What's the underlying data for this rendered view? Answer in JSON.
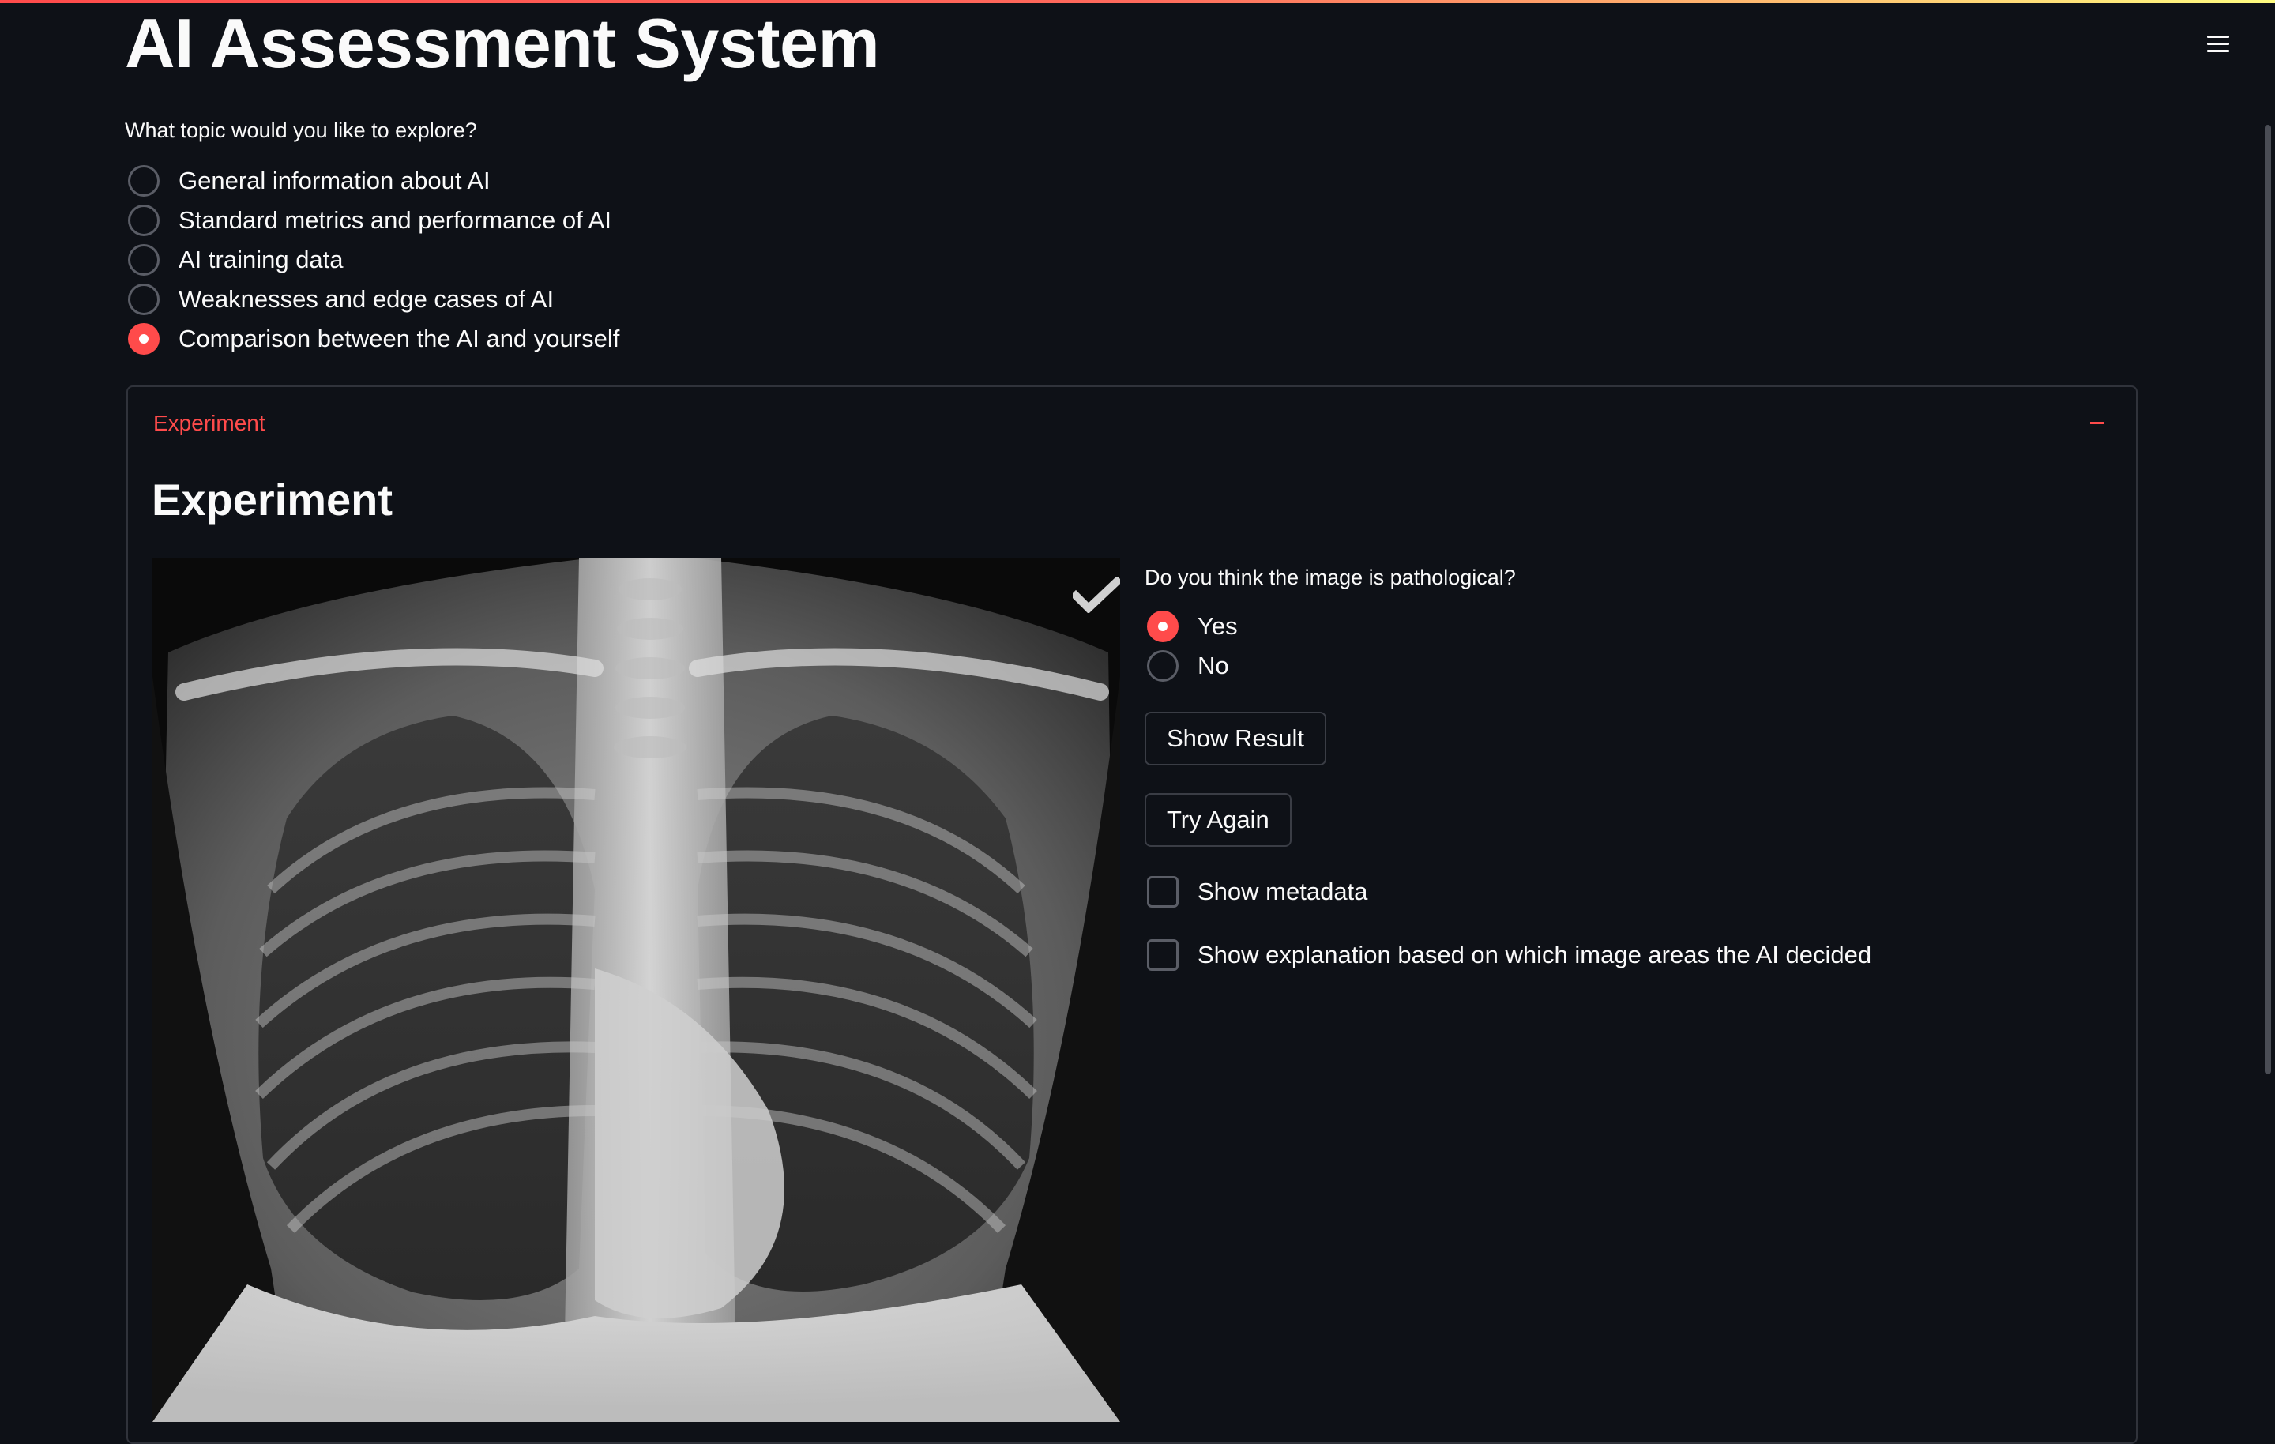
{
  "app": {
    "title": "AI Assessment System"
  },
  "topic": {
    "question": "What topic would you like to explore?",
    "options": [
      "General information about AI",
      "Standard metrics and performance of AI",
      "AI training data",
      "Weaknesses and edge cases of AI",
      "Comparison between the AI and yourself"
    ],
    "selected": "Comparison between the AI and yourself"
  },
  "expander": {
    "label": "Experiment",
    "expanded": true,
    "toggle_icon": "minus-icon"
  },
  "experiment": {
    "heading": "Experiment",
    "image_icon": "chest-xray-image",
    "overlay_icon": "checkmark-icon",
    "pathology_question": "Do you think the image is pathological?",
    "answer_options": [
      "Yes",
      "No"
    ],
    "answer_selected": "Yes",
    "show_result_label": "Show Result",
    "try_again_label": "Try Again",
    "show_metadata_label": "Show metadata",
    "show_metadata_checked": false,
    "show_explanation_label": "Show explanation based on which image areas the AI decided",
    "show_explanation_checked": false
  },
  "colors": {
    "background": "#0e1117",
    "accent": "#ff4b4b",
    "text": "#fafafa",
    "border": "#30333b"
  }
}
